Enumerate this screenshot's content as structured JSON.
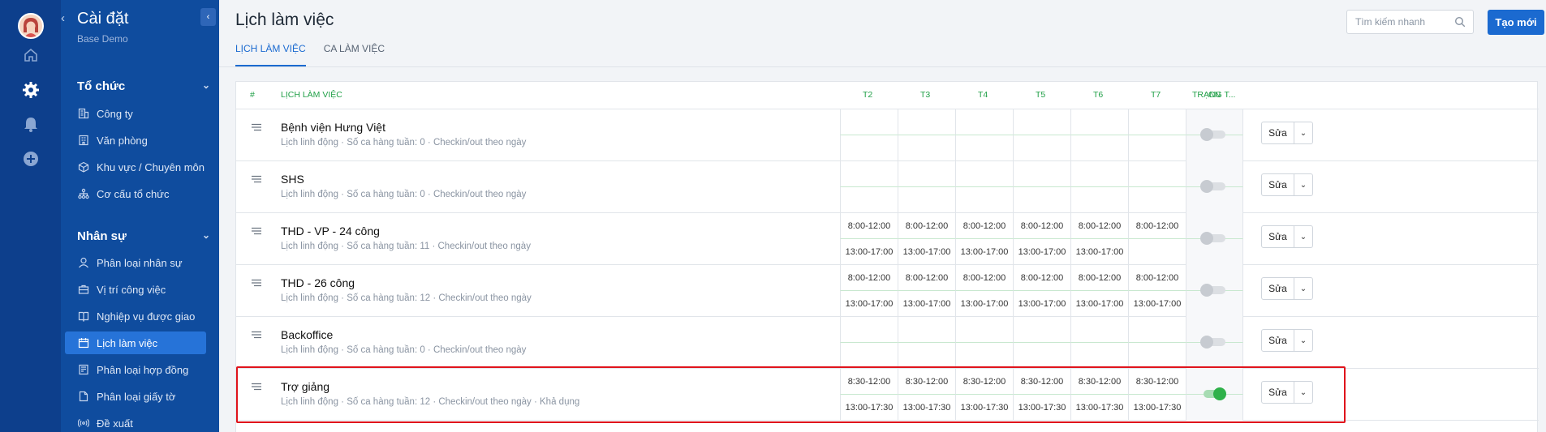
{
  "sidebar": {
    "title": "Cài đặt",
    "subtitle": "Base Demo",
    "groups": [
      {
        "label": "Tổ chức"
      },
      {
        "label": "Nhân sự"
      }
    ],
    "items": [
      {
        "label": "Công ty",
        "icon": "building-icon"
      },
      {
        "label": "Văn phòng",
        "icon": "office-icon"
      },
      {
        "label": "Khu vực / Chuyên môn",
        "icon": "cube-icon"
      },
      {
        "label": "Cơ cấu tổ chức",
        "icon": "org-chart-icon"
      },
      {
        "label": "Phân loại nhân sự",
        "icon": "user-icon"
      },
      {
        "label": "Vị trí công việc",
        "icon": "briefcase-icon"
      },
      {
        "label": "Nghiệp vụ được giao",
        "icon": "book-icon"
      },
      {
        "label": "Lịch làm việc",
        "icon": "calendar-icon"
      },
      {
        "label": "Phân loại hợp đồng",
        "icon": "contract-icon"
      },
      {
        "label": "Phân loại giấy tờ",
        "icon": "document-icon"
      },
      {
        "label": "Đề xuất",
        "icon": "broadcast-icon"
      }
    ]
  },
  "header": {
    "title": "Lịch làm việc",
    "tabs": [
      {
        "label": "LỊCH LÀM VIỆC"
      },
      {
        "label": "CA LÀM VIỆC"
      }
    ],
    "search_placeholder": "Tìm kiếm nhanh",
    "new_button": "Tạo mới"
  },
  "table": {
    "headers": {
      "index": "#",
      "schedule": "LỊCH LÀM VIỆC",
      "days": [
        "T2",
        "T3",
        "T4",
        "T5",
        "T6",
        "T7",
        "CN"
      ],
      "status": "TRẠNG T..."
    },
    "edit_label": "Sửa",
    "rows": [
      {
        "name": "Bệnh viện Hưng Việt",
        "meta": "Lịch linh động · Số ca hàng tuần: 0 · Checkin/out theo ngày",
        "active": false,
        "top": [
          "",
          "",
          "",
          "",
          "",
          ""
        ],
        "bottom": [
          "",
          "",
          "",
          "",
          "",
          ""
        ]
      },
      {
        "name": "SHS",
        "meta": "Lịch linh động · Số ca hàng tuần: 0 · Checkin/out theo ngày",
        "active": false,
        "top": [
          "",
          "",
          "",
          "",
          "",
          ""
        ],
        "bottom": [
          "",
          "",
          "",
          "",
          "",
          ""
        ]
      },
      {
        "name": "THD - VP - 24 công",
        "meta": "Lịch linh động · Số ca hàng tuần: 11 · Checkin/out theo ngày",
        "active": false,
        "top": [
          "8:00-12:00",
          "8:00-12:00",
          "8:00-12:00",
          "8:00-12:00",
          "8:00-12:00",
          "8:00-12:00"
        ],
        "bottom": [
          "13:00-17:00",
          "13:00-17:00",
          "13:00-17:00",
          "13:00-17:00",
          "13:00-17:00",
          ""
        ]
      },
      {
        "name": "THD - 26 công",
        "meta": "Lịch linh động · Số ca hàng tuần: 12 · Checkin/out theo ngày",
        "active": false,
        "top": [
          "8:00-12:00",
          "8:00-12:00",
          "8:00-12:00",
          "8:00-12:00",
          "8:00-12:00",
          "8:00-12:00"
        ],
        "bottom": [
          "13:00-17:00",
          "13:00-17:00",
          "13:00-17:00",
          "13:00-17:00",
          "13:00-17:00",
          "13:00-17:00"
        ]
      },
      {
        "name": "Backoffice",
        "meta": "Lịch linh động · Số ca hàng tuần: 0 · Checkin/out theo ngày",
        "active": false,
        "top": [
          "",
          "",
          "",
          "",
          "",
          ""
        ],
        "bottom": [
          "",
          "",
          "",
          "",
          "",
          ""
        ]
      },
      {
        "name": "Trợ giảng",
        "meta": "Lịch linh động · Số ca hàng tuần: 12 · Checkin/out theo ngày · Khả dụng",
        "active": true,
        "top": [
          "8:30-12:00",
          "8:30-12:00",
          "8:30-12:00",
          "8:30-12:00",
          "8:30-12:00",
          "8:30-12:00"
        ],
        "bottom": [
          "13:00-17:30",
          "13:00-17:30",
          "13:00-17:30",
          "13:00-17:30",
          "13:00-17:30",
          "13:00-17:30"
        ]
      }
    ]
  },
  "colors": {
    "rail": "#0d3f8c",
    "sidebar": "#0f4c9e",
    "accent": "#1b6ad0",
    "header_green": "#21a048",
    "toggle_on": "#2fb14a",
    "highlight": "#e0141c"
  }
}
